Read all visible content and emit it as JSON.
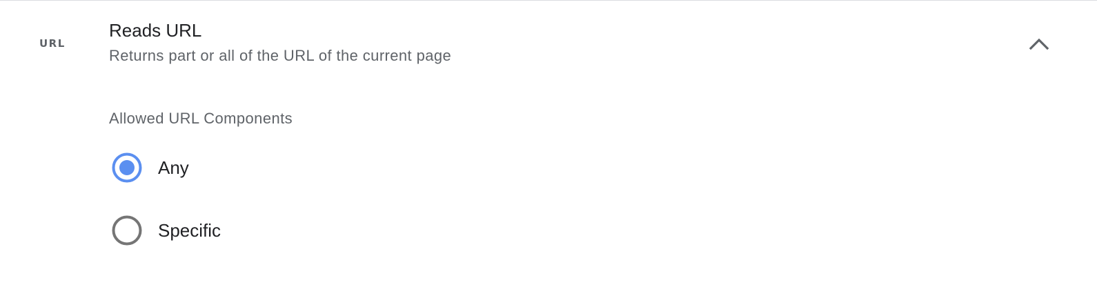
{
  "header": {
    "type_icon_label": "URL",
    "title": "Reads URL",
    "subtitle": "Returns part or all of the URL of the current page",
    "expanded": true,
    "collapse_icon": "chevron-up-icon"
  },
  "allowed_components": {
    "label": "Allowed URL Components",
    "options": [
      {
        "label": "Any",
        "selected": true
      },
      {
        "label": "Specific",
        "selected": false
      }
    ]
  },
  "colors": {
    "accent": "#5b8ff0",
    "unselected_radio": "#757575",
    "text_primary": "#202124",
    "text_secondary": "#5f6368"
  }
}
